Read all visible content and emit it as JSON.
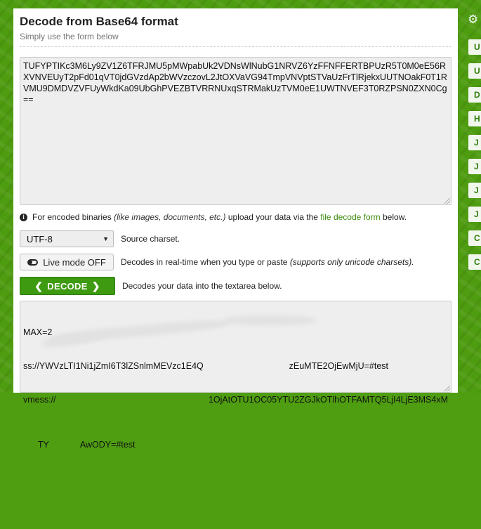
{
  "header": {
    "title": "Decode from Base64 format",
    "subtitle": "Simply use the form below"
  },
  "input": {
    "value": "TUFYPTIKc3M6Ly9ZV1Z6TFRJMU5pMWpabUk2VDNsWlNubG1NRVZ6YzFFNFFERTBPUzR5T0M0eE56RXVNVEUyT2pFd01qVT0jdGVzdAp2bWVzczovL2JtOXVaVG94TmpVNVptSTVaUzFrTlRjekxUUTNOakF0T1RVMU9DMDVZVFUyWkdKa09UbGhPVEZBTVRRNUxqSTRMakUzTVM0eE1UWTNVEF3T0RZPSN0ZXN0Cg=="
  },
  "info": {
    "prefix": "For encoded binaries",
    "examples": "(like images, documents, etc.)",
    "middle": "upload your data via the",
    "link": "file decode form",
    "suffix": "below."
  },
  "charset": {
    "selected": "UTF-8",
    "description": "Source charset."
  },
  "live_mode": {
    "label": "Live mode OFF",
    "description": "Decodes in real-time when you type or paste",
    "note": "(supports only unicode charsets)."
  },
  "decode": {
    "label": "DECODE",
    "description": "Decodes your data into the textarea below."
  },
  "output": {
    "line1": "MAX=2",
    "line2_start": "ss://YWVzLTI1Ni1jZmI6T3lZSnlmMEVzc1E4Q",
    "line2_end": "zEuMTE2OjEwMjU=#test",
    "line3_start": "vmess://",
    "line3_end": "1OjAtOTU1OC05YTU2ZGJkOTlhOTFAMTQ5LjI4LjE3MS4xM",
    "line4_start": "TY",
    "line4_end": "AwODY=#test"
  },
  "sidebar": {
    "items": [
      "U",
      "U",
      "D",
      "H",
      "J",
      "J",
      "J",
      "J",
      "C",
      "C"
    ]
  },
  "icons": {
    "settings": "gear-icon",
    "info": "info-icon",
    "toggle": "toggle-off-icon",
    "dropdown": "caret-down-icon"
  },
  "colors": {
    "brand_green": "#4e9c10",
    "button_green": "#3e9a10",
    "link_green": "#3c8a0e"
  }
}
